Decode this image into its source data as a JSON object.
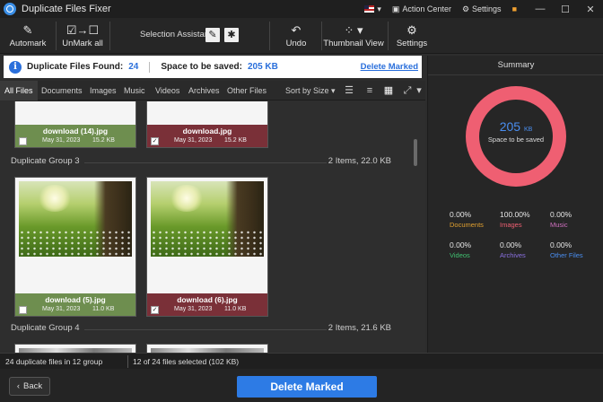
{
  "app": {
    "title": "Duplicate Files Fixer"
  },
  "titlebar": {
    "action_center": "Action Center",
    "settings": "Settings"
  },
  "toolbar": {
    "automark": "Automark",
    "unmark_all": "UnMark all",
    "selection_assistant": "Selection Assistant",
    "undo": "Undo",
    "thumbnail_view": "Thumbnail View",
    "settings": "Settings"
  },
  "infobar": {
    "found_label": "Duplicate Files Found:",
    "found_count": "24",
    "space_label": "Space to be saved:",
    "space_value": "205 KB",
    "delete_link": "Delete Marked"
  },
  "tabs": [
    "All Files",
    "Documents",
    "Images",
    "Music",
    "Videos",
    "Archives",
    "Other Files"
  ],
  "sort_label": "Sort by Size",
  "groups": [
    {
      "cards": [
        {
          "name": "download (14).jpg",
          "date": "May 31, 2023",
          "size": "15.2 KB",
          "checked": ""
        },
        {
          "name": "download.jpg",
          "date": "May 31, 2023",
          "size": "15.2 KB",
          "checked": "✓"
        }
      ]
    },
    {
      "title": "Duplicate Group 3",
      "meta": "2 Items, 22.0 KB",
      "cards": [
        {
          "name": "download (5).jpg",
          "date": "May 31, 2023",
          "size": "11.0 KB",
          "checked": ""
        },
        {
          "name": "download (6).jpg",
          "date": "May 31, 2023",
          "size": "11.0 KB",
          "checked": "✓"
        }
      ]
    },
    {
      "title": "Duplicate Group 4",
      "meta": "2 Items, 21.6 KB"
    }
  ],
  "summary": {
    "title": "Summary",
    "value": "205",
    "unit": "KB",
    "label": "Space to be saved",
    "ring_color": "#ef5f72",
    "stats": [
      {
        "pct": "0.00%",
        "label": "Documents",
        "color": "#e0a030"
      },
      {
        "pct": "100.00%",
        "label": "Images",
        "color": "#ef5f72"
      },
      {
        "pct": "0.00%",
        "label": "Music",
        "color": "#d070c0"
      },
      {
        "pct": "0.00%",
        "label": "Videos",
        "color": "#40c070"
      },
      {
        "pct": "0.00%",
        "label": "Archives",
        "color": "#8a70e0"
      },
      {
        "pct": "0.00%",
        "label": "Other Files",
        "color": "#4a8ef0"
      }
    ]
  },
  "status": {
    "left": "24 duplicate files in 12 group",
    "right": "12 of 24 files selected  (102 KB)"
  },
  "footer": {
    "back": "Back",
    "delete": "Delete Marked"
  }
}
